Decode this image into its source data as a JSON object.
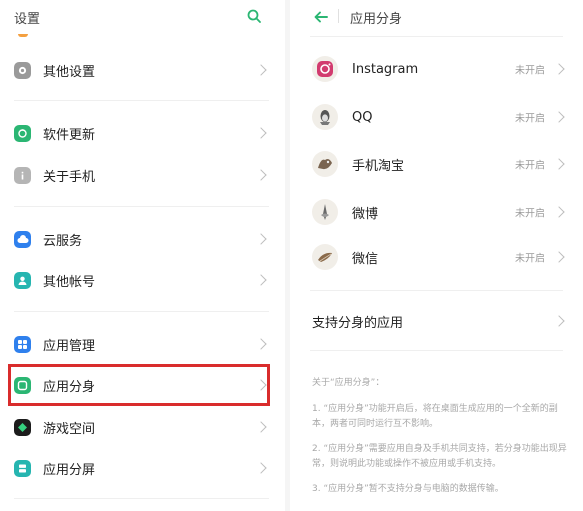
{
  "left": {
    "title": "设置",
    "items": [
      {
        "label": "其他设置"
      },
      {
        "label": "软件更新"
      },
      {
        "label": "关于手机"
      },
      {
        "label": "云服务"
      },
      {
        "label": "其他帐号"
      },
      {
        "label": "应用管理"
      },
      {
        "label": "应用分身"
      },
      {
        "label": "游戏空间"
      },
      {
        "label": "应用分屏"
      }
    ]
  },
  "right": {
    "title": "应用分身",
    "apps": [
      {
        "label": "Instagram",
        "status": "未开启"
      },
      {
        "label": "QQ",
        "status": "未开启"
      },
      {
        "label": "手机淘宝",
        "status": "未开启"
      },
      {
        "label": "微博",
        "status": "未开启"
      },
      {
        "label": "微信",
        "status": "未开启"
      }
    ],
    "supported_label": "支持分身的应用",
    "about_title": "关于“应用分身”：",
    "notes": [
      "1. “应用分身”功能开启后，将在桌面生成应用的一个全新的副本，两者可同时运行互不影响。",
      "2. “应用分身”需要应用自身及手机共同支持，若分身功能出现异常，则说明此功能或操作不被应用或手机支持。",
      "3. “应用分身”暂不支持分身与电脑的数据传输。"
    ]
  },
  "colors": {
    "accent_green": "#2bb673",
    "highlight_red": "#d92c2c"
  }
}
